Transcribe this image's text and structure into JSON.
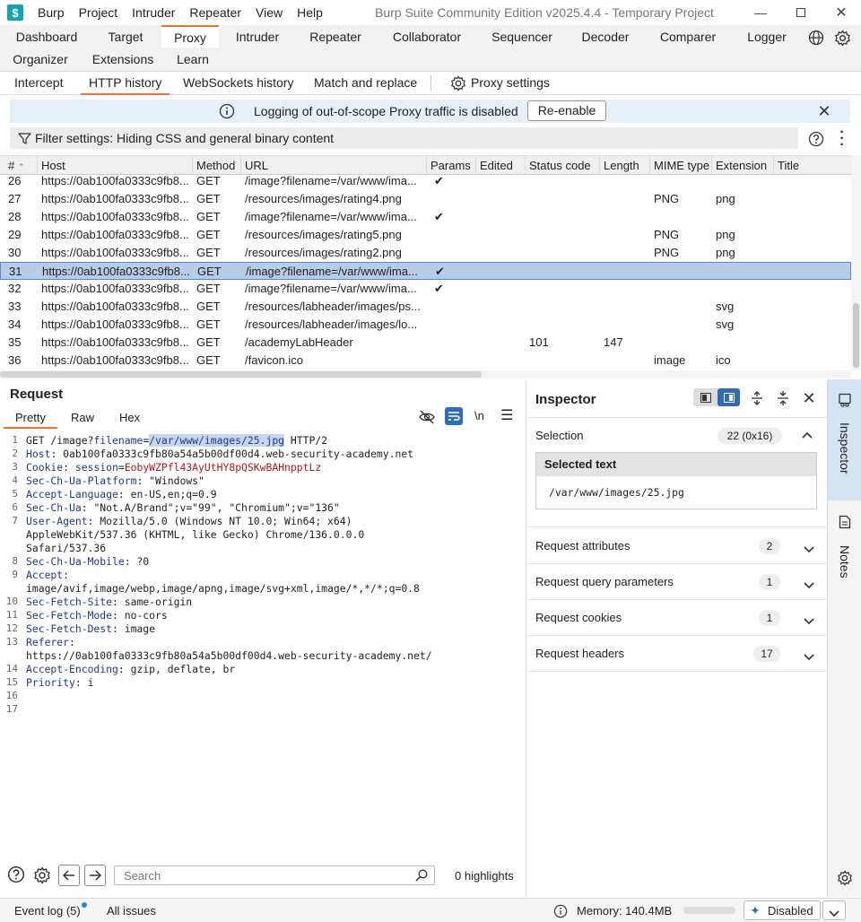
{
  "app": {
    "title": "Burp Suite Community Edition v2025.4.4 - Temporary Project",
    "logo_glyph": "$",
    "menu": [
      "Burp",
      "Project",
      "Intruder",
      "Repeater",
      "View",
      "Help"
    ]
  },
  "main_tabs": {
    "row1": [
      "Dashboard",
      "Target",
      "Proxy",
      "Intruder",
      "Repeater",
      "Collaborator",
      "Sequencer",
      "Decoder",
      "Comparer",
      "Logger"
    ],
    "row2": [
      "Organizer",
      "Extensions",
      "Learn"
    ],
    "active": "Proxy"
  },
  "proxy_tabs": {
    "items": [
      "Intercept",
      "HTTP history",
      "WebSockets history",
      "Match and replace"
    ],
    "settings_label": "Proxy settings",
    "active": "HTTP history"
  },
  "banner": {
    "message": "Logging of out-of-scope Proxy traffic is disabled",
    "button": "Re-enable"
  },
  "filter": {
    "label": "Filter settings: Hiding CSS and general binary content"
  },
  "history_table": {
    "columns": [
      "#",
      "Host",
      "Method",
      "URL",
      "Params",
      "Edited",
      "Status code",
      "Length",
      "MIME type",
      "Extension",
      "Title"
    ],
    "rows": [
      {
        "num": "26",
        "host": "https://0ab100fa0333c9fb8...",
        "method": "GET",
        "url": "/image?filename=/var/www/ima...",
        "params": "✔",
        "status": "",
        "length": "",
        "mime": "",
        "ext": ""
      },
      {
        "num": "27",
        "host": "https://0ab100fa0333c9fb8...",
        "method": "GET",
        "url": "/resources/images/rating4.png",
        "params": "",
        "status": "",
        "length": "",
        "mime": "PNG",
        "ext": "png"
      },
      {
        "num": "28",
        "host": "https://0ab100fa0333c9fb8...",
        "method": "GET",
        "url": "/image?filename=/var/www/ima...",
        "params": "✔",
        "status": "",
        "length": "",
        "mime": "",
        "ext": ""
      },
      {
        "num": "29",
        "host": "https://0ab100fa0333c9fb8...",
        "method": "GET",
        "url": "/resources/images/rating5.png",
        "params": "",
        "status": "",
        "length": "",
        "mime": "PNG",
        "ext": "png"
      },
      {
        "num": "30",
        "host": "https://0ab100fa0333c9fb8...",
        "method": "GET",
        "url": "/resources/images/rating2.png",
        "params": "",
        "status": "",
        "length": "",
        "mime": "PNG",
        "ext": "png"
      },
      {
        "num": "31",
        "host": "https://0ab100fa0333c9fb8...",
        "method": "GET",
        "url": "/image?filename=/var/www/ima...",
        "params": "✔",
        "status": "",
        "length": "",
        "mime": "",
        "ext": "",
        "selected": true
      },
      {
        "num": "32",
        "host": "https://0ab100fa0333c9fb8...",
        "method": "GET",
        "url": "/image?filename=/var/www/ima...",
        "params": "✔",
        "status": "",
        "length": "",
        "mime": "",
        "ext": ""
      },
      {
        "num": "33",
        "host": "https://0ab100fa0333c9fb8...",
        "method": "GET",
        "url": "/resources/labheader/images/ps...",
        "params": "",
        "status": "",
        "length": "",
        "mime": "",
        "ext": "svg"
      },
      {
        "num": "34",
        "host": "https://0ab100fa0333c9fb8...",
        "method": "GET",
        "url": "/resources/labheader/images/lo...",
        "params": "",
        "status": "",
        "length": "",
        "mime": "",
        "ext": "svg"
      },
      {
        "num": "35",
        "host": "https://0ab100fa0333c9fb8...",
        "method": "GET",
        "url": "/academyLabHeader",
        "params": "",
        "status": "101",
        "length": "147",
        "mime": "",
        "ext": ""
      },
      {
        "num": "36",
        "host": "https://0ab100fa0333c9fb8...",
        "method": "GET",
        "url": "/favicon.ico",
        "params": "",
        "status": "",
        "length": "",
        "mime": "image",
        "ext": "ico"
      }
    ]
  },
  "request": {
    "title": "Request",
    "tabs": [
      "Pretty",
      "Raw",
      "Hex"
    ],
    "active_tab": "Pretty",
    "newline_toggle": "\\n",
    "lines": [
      {
        "n": "1",
        "parts": [
          [
            "GET /image?",
            ""
          ],
          [
            "filename",
            "blue"
          ],
          [
            "=",
            ""
          ],
          [
            "/var/www/images/25.jpg",
            "sel"
          ],
          [
            " HTTP/2",
            ""
          ]
        ]
      },
      {
        "n": "2",
        "parts": [
          [
            "Host",
            "hk"
          ],
          [
            ": 0ab100fa0333c9fb80a54a5b00df00d4.web-security-academy.net",
            ""
          ]
        ]
      },
      {
        "n": "3",
        "parts": [
          [
            "Cookie",
            "hk"
          ],
          [
            ": ",
            ""
          ],
          [
            "session",
            "blue"
          ],
          [
            "=",
            ""
          ],
          [
            "EobyWZPfl43AyUtHY8pQSKwBAHnpptLz",
            "red"
          ]
        ]
      },
      {
        "n": "4",
        "parts": [
          [
            "Sec-Ch-Ua-Platform",
            "hk"
          ],
          [
            ": \"Windows\"",
            ""
          ]
        ]
      },
      {
        "n": "5",
        "parts": [
          [
            "Accept-Language",
            "hk"
          ],
          [
            ": en-US,en;q=0.9",
            ""
          ]
        ]
      },
      {
        "n": "6",
        "parts": [
          [
            "Sec-Ch-Ua",
            "hk"
          ],
          [
            ": \"Not.A/Brand\";v=\"99\", \"Chromium\";v=\"136\"",
            ""
          ]
        ]
      },
      {
        "n": "7",
        "parts": [
          [
            "User-Agent",
            "hk"
          ],
          [
            ": Mozilla/5.0 (Windows NT 10.0; Win64; x64)",
            ""
          ]
        ]
      },
      {
        "n": "",
        "parts": [
          [
            "AppleWebKit/537.36 (KHTML, like Gecko) Chrome/136.0.0.0",
            ""
          ]
        ]
      },
      {
        "n": "",
        "parts": [
          [
            "Safari/537.36",
            ""
          ]
        ]
      },
      {
        "n": "8",
        "parts": [
          [
            "Sec-Ch-Ua-Mobile",
            "hk"
          ],
          [
            ": ?0",
            ""
          ]
        ]
      },
      {
        "n": "9",
        "parts": [
          [
            "Accept",
            "hk"
          ],
          [
            ":",
            ""
          ]
        ]
      },
      {
        "n": "",
        "parts": [
          [
            "image/avif,image/webp,image/apng,image/svg+xml,image/*,*/*;q=0.8",
            ""
          ]
        ]
      },
      {
        "n": "10",
        "parts": [
          [
            "Sec-Fetch-Site",
            "hk"
          ],
          [
            ": same-origin",
            ""
          ]
        ]
      },
      {
        "n": "11",
        "parts": [
          [
            "Sec-Fetch-Mode",
            "hk"
          ],
          [
            ": no-cors",
            ""
          ]
        ]
      },
      {
        "n": "12",
        "parts": [
          [
            "Sec-Fetch-Dest",
            "hk"
          ],
          [
            ": image",
            ""
          ]
        ]
      },
      {
        "n": "13",
        "parts": [
          [
            "Referer",
            "hk"
          ],
          [
            ":",
            ""
          ]
        ]
      },
      {
        "n": "",
        "parts": [
          [
            "https://0ab100fa0333c9fb80a54a5b00df00d4.web-security-academy.net/",
            ""
          ]
        ]
      },
      {
        "n": "14",
        "parts": [
          [
            "Accept-Encoding",
            "hk"
          ],
          [
            ": gzip, deflate, br",
            ""
          ]
        ]
      },
      {
        "n": "15",
        "parts": [
          [
            "Priority",
            "hk"
          ],
          [
            ": i",
            ""
          ]
        ]
      },
      {
        "n": "16",
        "parts": []
      },
      {
        "n": "17",
        "parts": []
      }
    ],
    "search_placeholder": "Search",
    "highlights": "0 highlights"
  },
  "inspector": {
    "title": "Inspector",
    "selection_label": "Selection",
    "selection_badge": "22 (0x16)",
    "selected_text_title": "Selected text",
    "selected_text": "/var/www/images/25.jpg",
    "sections": [
      {
        "label": "Request attributes",
        "count": "2"
      },
      {
        "label": "Request query parameters",
        "count": "1"
      },
      {
        "label": "Request cookies",
        "count": "1"
      },
      {
        "label": "Request headers",
        "count": "17"
      }
    ]
  },
  "rail": {
    "items": [
      "Inspector",
      "Notes"
    ]
  },
  "status_bar": {
    "event_log": "Event log (5)",
    "all_issues": "All issues",
    "memory": "Memory: 140.4MB",
    "ai_status": "Disabled"
  },
  "colors": {
    "accent": "#e8743b",
    "selection": "#b6cce9",
    "banner": "#e5f0f9",
    "header_key": "#1f3a8a",
    "cookie_value": "#b01818"
  }
}
